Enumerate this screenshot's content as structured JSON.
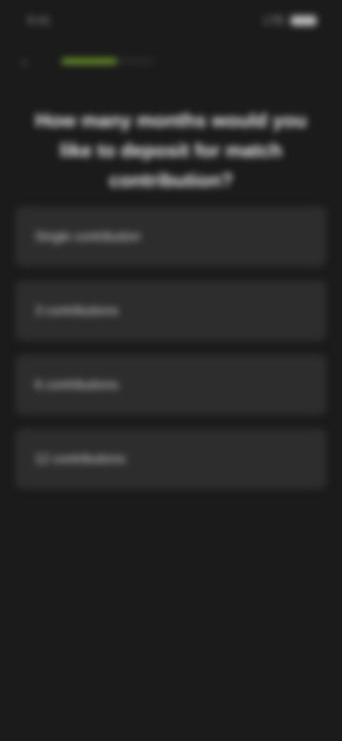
{
  "status_bar": {
    "time": "9:41",
    "network": "LTE"
  },
  "header": {
    "progress_fraction": 0.6
  },
  "question": {
    "text": "How many months would you like to deposit for match contribution?"
  },
  "options": [
    {
      "label": "Single contribution"
    },
    {
      "label": "3 contributions"
    },
    {
      "label": "6 contributions"
    },
    {
      "label": "12 contributions"
    }
  ]
}
